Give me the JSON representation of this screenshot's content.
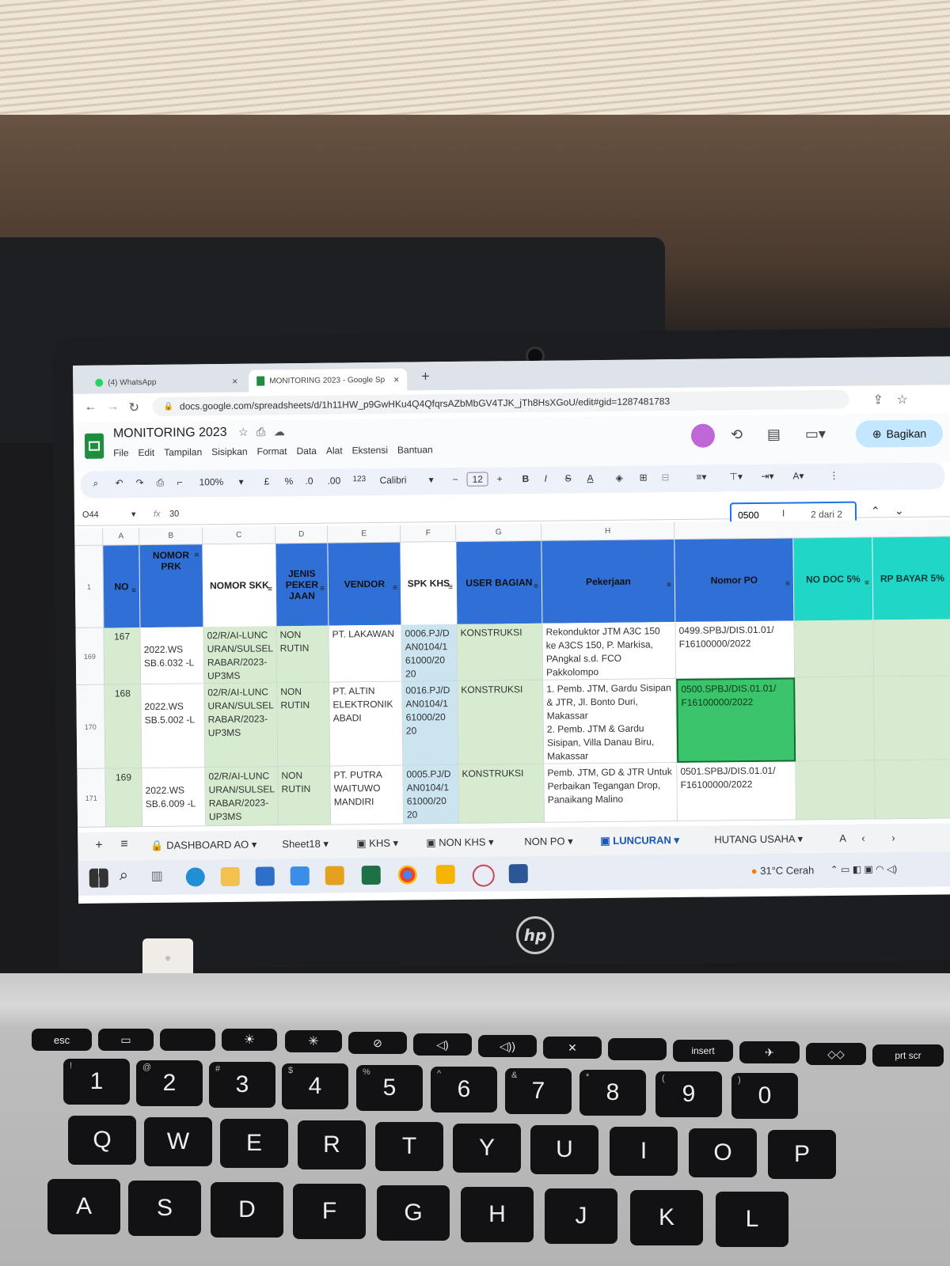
{
  "browser": {
    "tabs": [
      {
        "label": "(4) WhatsApp",
        "close": "×"
      },
      {
        "label": "MONITORING 2023 - Google Sp",
        "close": "×"
      }
    ],
    "new_tab": "+",
    "url": "docs.google.com/spreadsheets/d/1h11HW_p9GwHKu4Q4QfqrsAZbMbGV4TJK_jTh8HsXGoU/edit#gid=1287481783"
  },
  "app": {
    "title": "MONITORING 2023",
    "menus": [
      "File",
      "Edit",
      "Tampilan",
      "Sisipkan",
      "Format",
      "Data",
      "Alat",
      "Ekstensi",
      "Bantuan"
    ],
    "share_label": "Bagikan"
  },
  "toolbar": {
    "zoom": "100%",
    "currency": "£",
    "percent": "%",
    "dec_down": ".0",
    "dec_up": ".00",
    "format123": "123",
    "font": "Calibri",
    "font_size": "12",
    "bold": "B",
    "italic": "I",
    "strike": "S",
    "text_color": "A"
  },
  "formula": {
    "cell_ref": "O44",
    "fx": "fx",
    "value": "30"
  },
  "find": {
    "query": "0500",
    "result": "2 dari 2"
  },
  "grid": {
    "column_letters": [
      "A",
      "B",
      "C",
      "D",
      "E",
      "F",
      "G",
      "H",
      ""
    ],
    "headers": [
      "NO",
      "NOMOR PRK",
      "NOMOR SKK",
      "JENIS PEKER JAAN",
      "VENDOR",
      "SPK KHS",
      "USER BAGIAN",
      "Pekerjaan",
      "Nomor PO",
      "NO DOC 5%",
      "RP BAYAR 5%"
    ],
    "header_row_num": "1",
    "rows": [
      {
        "row_num": "169",
        "no": "167",
        "prk": "2022.WS SB.6.032 -L",
        "skk": "02/R/AI-LUNC URAN/SULSEL RABAR/2023- UP3MS",
        "jenis": "NON RUTIN",
        "vendor": "PT. LAKAWAN",
        "spk": "0006.PJ/D AN0104/1 61000/20 20",
        "user": "KONSTRUKSI",
        "pekerjaan": "Rekonduktor JTM A3C 150 ke A3CS 150, P. Markisa, PAngkal s.d. FCO Pakkolompo",
        "po": "0499.SPBJ/DIS.01.01/ F16100000/2022"
      },
      {
        "row_num": "170",
        "no": "168",
        "prk": "2022.WS SB.5.002 -L",
        "skk": "02/R/AI-LUNC URAN/SULSEL RABAR/2023- UP3MS",
        "jenis": "NON RUTIN",
        "vendor": "PT. ALTIN ELEKTRONIK ABADI",
        "spk": "0016.PJ/D AN0104/1 61000/20 20",
        "user": "KONSTRUKSI",
        "pekerjaan": "1. Pemb. JTM, Gardu Sisipan & JTR, Jl. Bonto Duri, Makassar\n2. Pemb. JTM & Gardu Sisipan, Villa Danau Biru, Makassar",
        "po": "0500.SPBJ/DIS.01.01/ F16100000/2022"
      },
      {
        "row_num": "171",
        "no": "169",
        "prk": "2022.WS SB.6.009 -L",
        "skk": "02/R/AI-LUNC URAN/SULSEL RABAR/2023- UP3MS",
        "jenis": "NON RUTIN",
        "vendor": "PT. PUTRA WAITUWO MANDIRI",
        "spk": "0005.PJ/D AN0104/1 61000/20 20",
        "user": "KONSTRUKSI",
        "pekerjaan": "Pemb. JTM, GD & JTR Untuk Perbaikan Tegangan Drop, Panaikang Malino",
        "po": "0501.SPBJ/DIS.01.01/ F16100000/2022"
      }
    ]
  },
  "sheet_tabs": [
    "DASHBOARD AO",
    "Sheet18",
    "KHS",
    "NON KHS",
    "NON PO",
    "LUNCURAN",
    "HUTANG USAHA",
    "A"
  ],
  "taskbar": {
    "weather": "31°C Cerah"
  },
  "keyboard": {
    "row_fn": [
      "esc",
      "insert",
      "prt scr"
    ],
    "row_num": [
      [
        "!",
        "1"
      ],
      [
        "@",
        "2"
      ],
      [
        "#",
        "3"
      ],
      [
        "$",
        "4"
      ],
      [
        "%",
        "5"
      ],
      [
        "^",
        "6"
      ],
      [
        "&",
        "7"
      ],
      [
        "*",
        "8"
      ],
      [
        "(",
        "9"
      ],
      [
        ")",
        "0"
      ]
    ],
    "row_q": [
      "Q",
      "W",
      "E",
      "R",
      "T",
      "Y",
      "U",
      "I",
      "O",
      "P"
    ],
    "row_a": [
      "A",
      "S",
      "D",
      "F",
      "G",
      "H",
      "J",
      "K",
      "L"
    ]
  },
  "colors": {
    "header_blue": "#2f6fd6",
    "header_teal": "#20d6c6",
    "row_green": "#d6ebcf",
    "selected_green": "#3cc46c",
    "find_border": "#1a73e8"
  }
}
